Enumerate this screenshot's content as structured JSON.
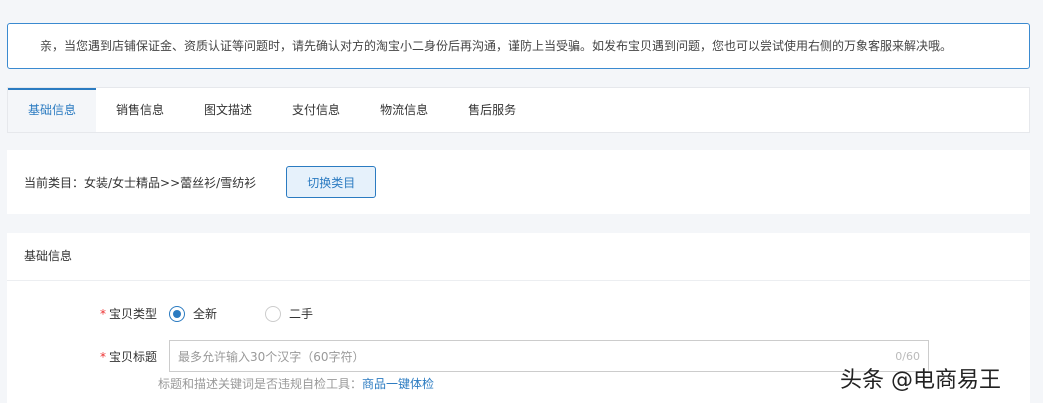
{
  "notice": "亲，当您遇到店铺保证金、资质认证等问题时，请先确认对方的淘宝小二身份后再沟通，谨防上当受骗。如发布宝贝遇到问题，您也可以尝试使用右侧的万象客服来解决哦。",
  "tabs": [
    "基础信息",
    "销售信息",
    "图文描述",
    "支付信息",
    "物流信息",
    "售后服务"
  ],
  "category": {
    "label": "当前类目：女装/女士精品>>蕾丝衫/雪纺衫",
    "button": "切换类目"
  },
  "form": {
    "title": "基础信息",
    "type": {
      "label": "宝贝类型",
      "options": [
        "全新",
        "二手"
      ],
      "selected": "全新"
    },
    "title_field": {
      "label": "宝贝标题",
      "placeholder": "最多允许输入30个汉字（60字符）",
      "count": "0/60"
    },
    "hint": "标题和描述关键词是否违规自检工具：",
    "hint_link": "商品一键体检"
  },
  "watermark": "头条 @电商易王"
}
